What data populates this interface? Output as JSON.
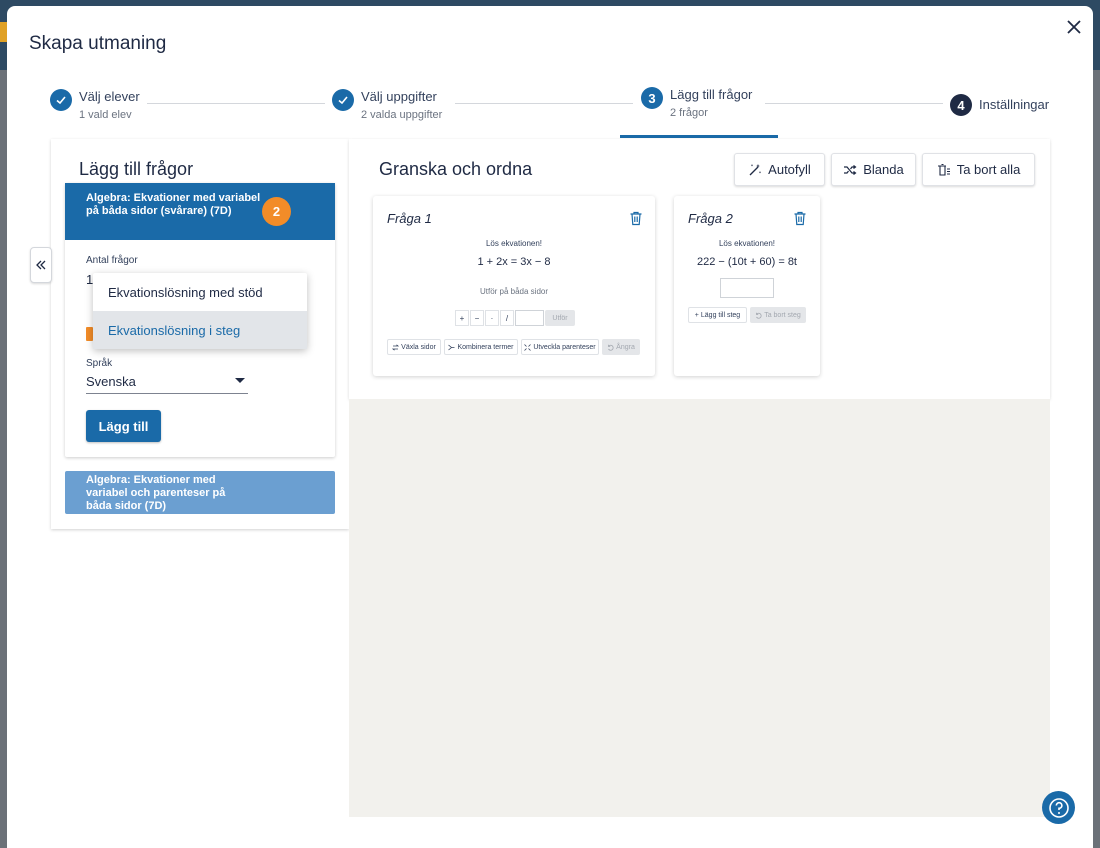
{
  "dialog": {
    "title": "Skapa utmaning"
  },
  "stepper": {
    "steps": [
      {
        "number": "1",
        "label": "Välj elever",
        "sub": "1 vald elev",
        "state": "done"
      },
      {
        "number": "2",
        "label": "Välj uppgifter",
        "sub": "2 valda uppgifter",
        "state": "done"
      },
      {
        "number": "3",
        "label": "Lägg till frågor",
        "sub": "2 frågor",
        "state": "active"
      },
      {
        "number": "4",
        "label": "Inställningar",
        "sub": "",
        "state": "pending"
      }
    ]
  },
  "left": {
    "title": "Lägg till frågor",
    "topic1": {
      "title": "Algebra: Ekvationer med variabel på båda sidor (svårare) (7D)",
      "count": "2",
      "count_label": "Antal frågor",
      "count_value": "1",
      "dropdown_options": [
        "Ekvationslösning med stöd",
        "Ekvationslösning i steg"
      ],
      "dropdown_selected": "Ekvationslösning i steg",
      "language_label": "Språk",
      "language_value": "Svenska",
      "add_label": "Lägg till"
    },
    "topic2": {
      "title": "Algebra: Ekvationer med variabel och parenteser på båda sidor (7D)"
    }
  },
  "right": {
    "title": "Granska och ordna",
    "toolbar": {
      "autofill": "Autofyll",
      "shuffle": "Blanda",
      "remove_all": "Ta bort alla"
    },
    "questions": [
      {
        "title": "Fråga 1",
        "instruction": "Lös ekvationen!",
        "equation": "1 + 2x = 3x − 8",
        "hint": "Utför på båda sidor",
        "ops": [
          "+",
          "−",
          "·",
          "/"
        ],
        "execute": "Utför",
        "actions": [
          "Växla sidor",
          "Kombinera termer",
          "Utveckla parenteser",
          "Ångra"
        ]
      },
      {
        "title": "Fråga 2",
        "instruction": "Lös ekvationen!",
        "equation": "222 − (10t + 60) = 8t",
        "actions": [
          "Lägg till steg",
          "Ta bort steg"
        ]
      }
    ]
  },
  "colors": {
    "primary": "#1a6aa8",
    "accent": "#f28c28",
    "dark": "#1f2a44",
    "topic_inactive": "#6b9fd1"
  }
}
